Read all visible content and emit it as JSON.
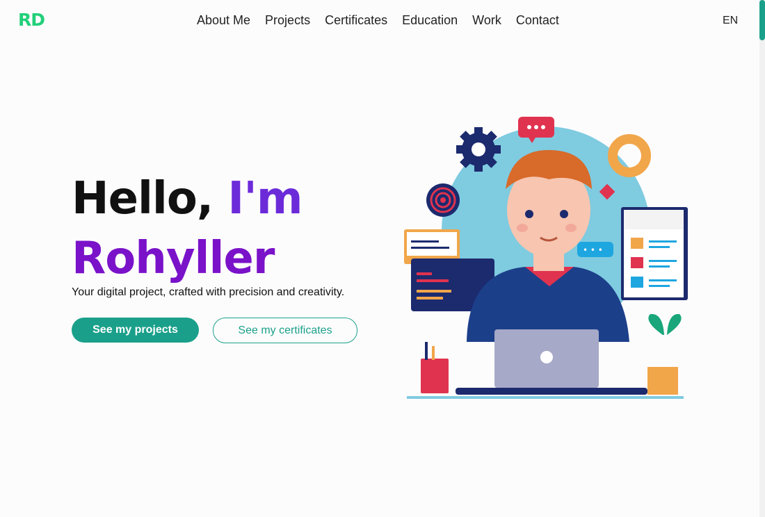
{
  "brand": {
    "logo_text": "RD"
  },
  "nav": {
    "items": [
      {
        "label": "About Me"
      },
      {
        "label": "Projects"
      },
      {
        "label": "Certificates"
      },
      {
        "label": "Education"
      },
      {
        "label": "Work"
      },
      {
        "label": "Contact"
      }
    ],
    "language": "EN"
  },
  "hero": {
    "greeting": "Hello,",
    "im": "I'm",
    "name": "Rohyller",
    "tagline": "Your digital project, crafted with precision and creativity.",
    "primary_cta": "See my projects",
    "secondary_cta": "See my certificates"
  },
  "colors": {
    "brand_green": "#21d07a",
    "accent_teal": "#1aa08a",
    "purple_light": "#6c2bd9",
    "purple_dark": "#7a12c9",
    "scroll_thumb": "#1aa08a"
  }
}
